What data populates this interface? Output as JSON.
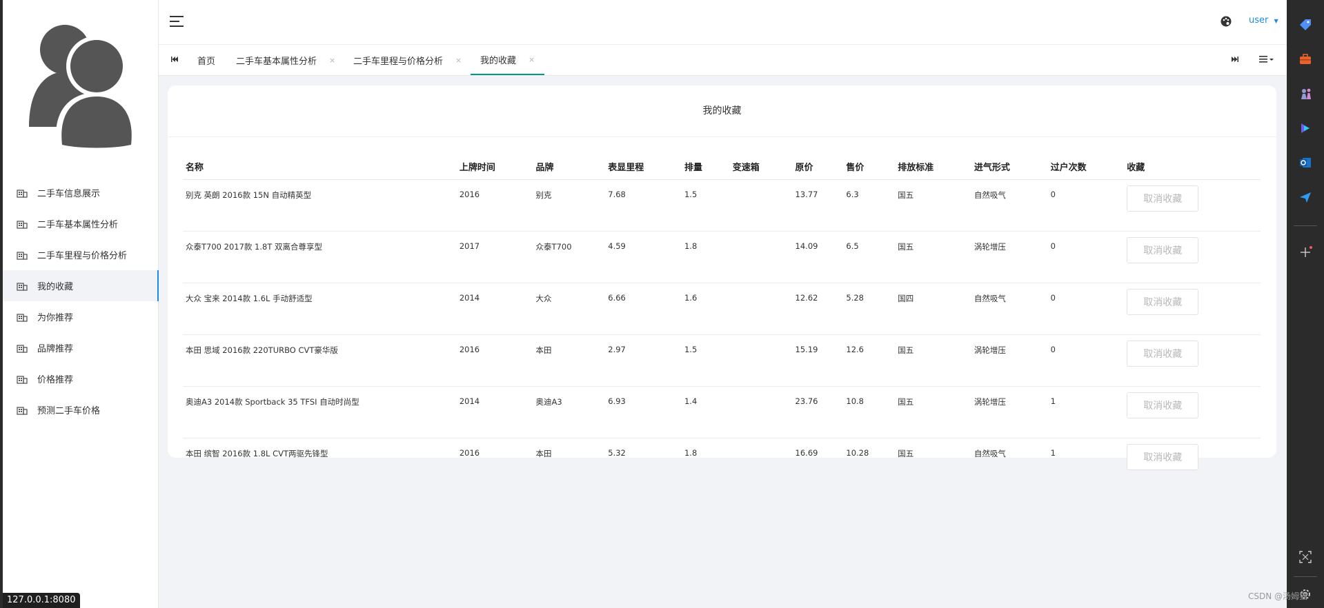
{
  "sidebar": {
    "items": [
      {
        "label": "二手车信息展示"
      },
      {
        "label": "二手车基本属性分析"
      },
      {
        "label": "二手车里程与价格分析"
      },
      {
        "label": "我的收藏",
        "active": true
      },
      {
        "label": "为你推荐"
      },
      {
        "label": "品牌推荐"
      },
      {
        "label": "价格推荐"
      },
      {
        "label": "预测二手车价格"
      }
    ]
  },
  "header": {
    "user_label": "user"
  },
  "tabs": [
    {
      "label": "首页",
      "closable": false
    },
    {
      "label": "二手车基本属性分析",
      "closable": true
    },
    {
      "label": "二手车里程与价格分析",
      "closable": true
    },
    {
      "label": "我的收藏",
      "closable": true,
      "active": true
    }
  ],
  "tab_close_glyph": "×",
  "card": {
    "title": "我的收藏",
    "columns": [
      "名称",
      "上牌时间",
      "品牌",
      "表显里程",
      "排量",
      "变速箱",
      "原价",
      "售价",
      "排放标准",
      "进气形式",
      "过户次数",
      "收藏"
    ],
    "rows": [
      {
        "name": "别克 英朗 2016款 15N 自动精英型",
        "year": "2016",
        "brand": "别克",
        "mileage": "7.68",
        "displacement": "1.5",
        "gearbox": "",
        "orig_price": "13.77",
        "price": "6.3",
        "emission": "国五",
        "intake": "自然吸气",
        "transfers": "0",
        "action": "取消收藏"
      },
      {
        "name": "众泰T700 2017款 1.8T 双离合尊享型",
        "year": "2017",
        "brand": "众泰T700",
        "mileage": "4.59",
        "displacement": "1.8",
        "gearbox": "",
        "orig_price": "14.09",
        "price": "6.5",
        "emission": "国五",
        "intake": "涡轮增压",
        "transfers": "0",
        "action": "取消收藏"
      },
      {
        "name": "大众 宝来 2014款 1.6L 手动舒适型",
        "year": "2014",
        "brand": "大众",
        "mileage": "6.66",
        "displacement": "1.6",
        "gearbox": "",
        "orig_price": "12.62",
        "price": "5.28",
        "emission": "国四",
        "intake": "自然吸气",
        "transfers": "0",
        "action": "取消收藏"
      },
      {
        "name": "本田 思域 2016款 220TURBO CVT豪华版",
        "year": "2016",
        "brand": "本田",
        "mileage": "2.97",
        "displacement": "1.5",
        "gearbox": "",
        "orig_price": "15.19",
        "price": "12.6",
        "emission": "国五",
        "intake": "涡轮增压",
        "transfers": "0",
        "action": "取消收藏"
      },
      {
        "name": "奥迪A3 2014款 Sportback 35 TFSI 自动时尚型",
        "year": "2014",
        "brand": "奥迪A3",
        "mileage": "6.93",
        "displacement": "1.4",
        "gearbox": "",
        "orig_price": "23.76",
        "price": "10.8",
        "emission": "国五",
        "intake": "涡轮增压",
        "transfers": "1",
        "action": "取消收藏"
      },
      {
        "name": "本田 缤智 2016款 1.8L CVT两驱先锋型",
        "year": "2016",
        "brand": "本田",
        "mileage": "5.32",
        "displacement": "1.8",
        "gearbox": "",
        "orig_price": "16.69",
        "price": "10.28",
        "emission": "国五",
        "intake": "自然吸气",
        "transfers": "1",
        "action": "取消收藏"
      }
    ]
  },
  "status_url": "127.0.0.1:8080",
  "watermark": "CSDN @汤姆猫",
  "colors": {
    "accent": "#1e88e5",
    "tab_active": "#009688",
    "sidebar_icon": "#555555"
  },
  "icons": {
    "menu": "building-icon",
    "rightbar": [
      "tag-icon",
      "briefcase-icon",
      "chess-icon",
      "copilot-icon",
      "outlook-icon",
      "send-icon",
      "plus-icon",
      "screenshot-icon",
      "settings-icon"
    ]
  }
}
